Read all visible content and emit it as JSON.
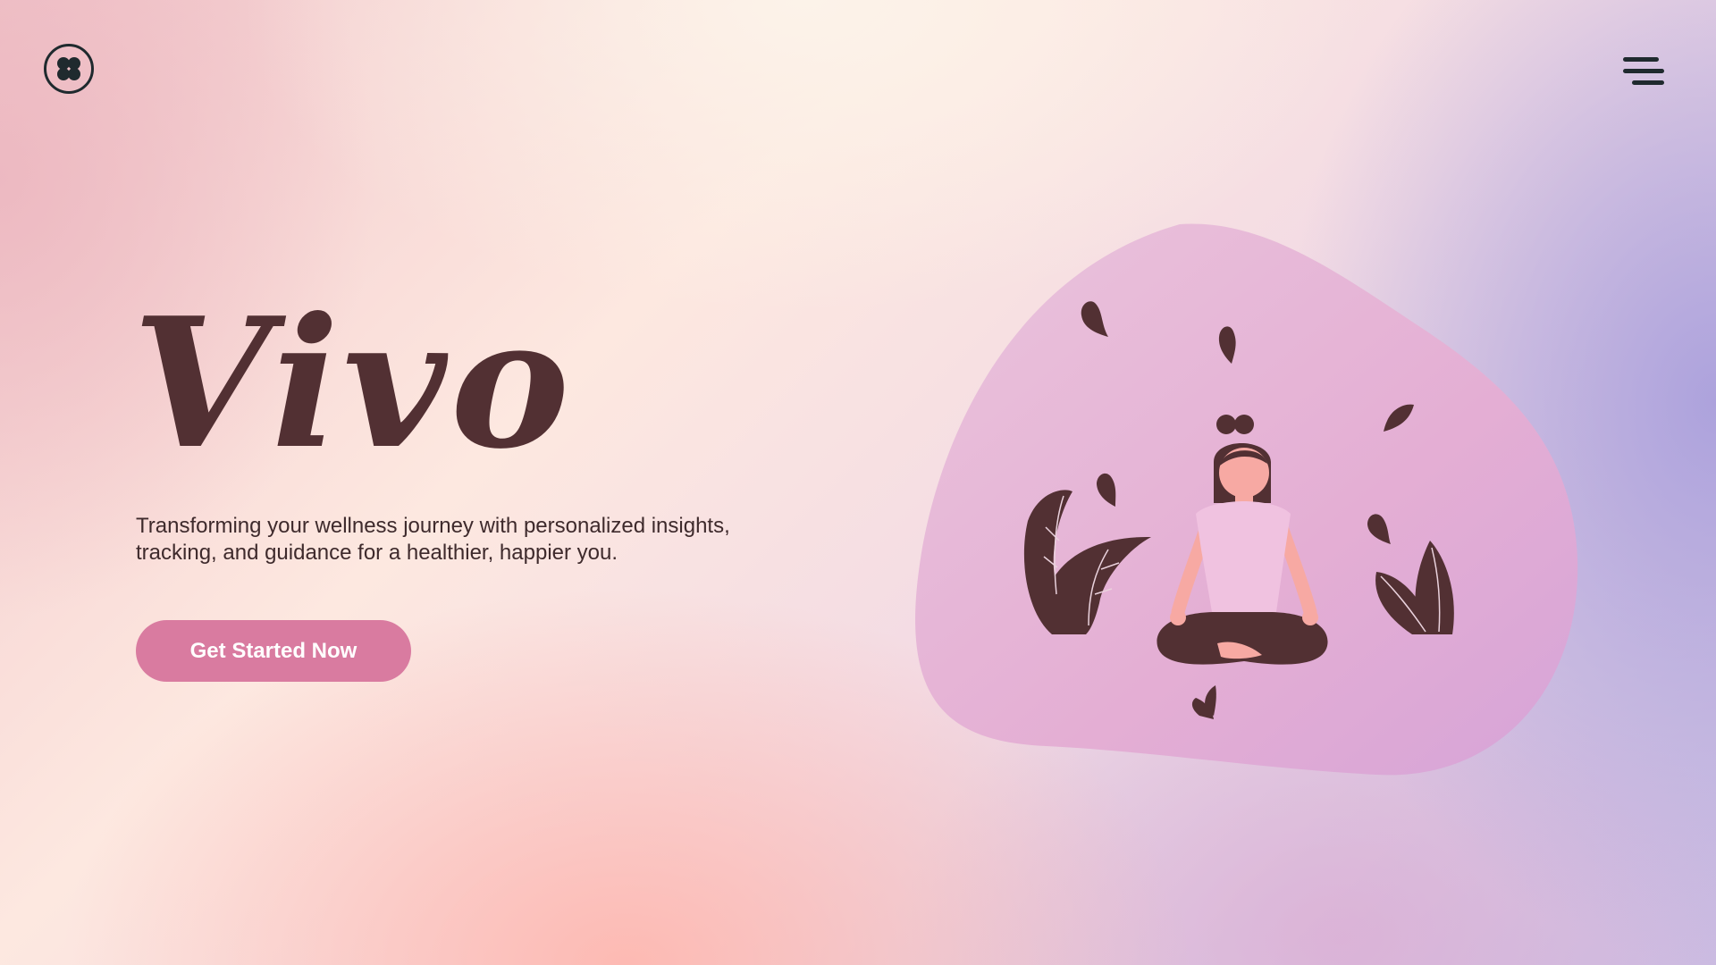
{
  "header": {
    "logo_icon": "four-leaf-clover-icon",
    "menu_icon": "hamburger-menu-icon"
  },
  "hero": {
    "title": "Vivo",
    "subtitle": "Transforming your wellness journey with personalized insights, tracking, and guidance for a healthier, happier you.",
    "cta_label": "Get Started Now"
  },
  "illustration": {
    "subject": "meditation-illustration"
  },
  "colors": {
    "brand_dark": "#523033",
    "button": "#d97ba0",
    "button_text": "#ffffff",
    "blob": "#e8b4d6",
    "skin": "#f7a9a3",
    "shirt": "#f0c2e0"
  }
}
